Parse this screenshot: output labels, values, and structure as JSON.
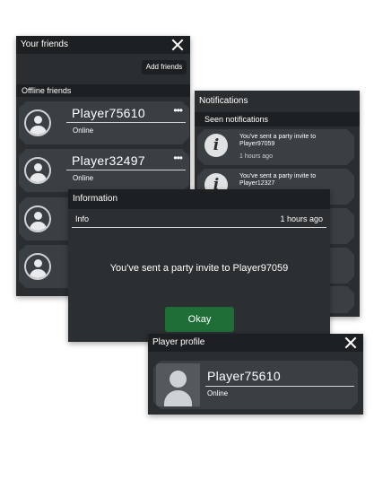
{
  "friends_panel": {
    "title": "Your friends",
    "add_friends_label": "Add friends",
    "offline_header": "Offline friends",
    "items": [
      {
        "name": "Player75610",
        "status": "Online",
        "menu": "•••"
      },
      {
        "name": "Player32497",
        "status": "Online",
        "menu": "•••"
      },
      {
        "name": "",
        "status": "",
        "menu": ""
      },
      {
        "name": "–",
        "status": "",
        "menu": ""
      }
    ]
  },
  "notifications_panel": {
    "title": "Notifications",
    "seen_header": "Seen notifications",
    "items": [
      {
        "icon": "info-icon",
        "text": "You've sent a party invite to Player97059",
        "time": "1 hours ago"
      },
      {
        "icon": "info-icon",
        "text": "You've sent a party invite to Player12327",
        "time": ""
      }
    ]
  },
  "info_modal": {
    "title": "Information",
    "header_label": "Info",
    "header_time": "1 hours ago",
    "message": "You've sent a party invite to Player97059",
    "okay_label": "Okay"
  },
  "player_profile": {
    "title": "Player profile",
    "name": "Player75610",
    "status": "Online"
  },
  "colors": {
    "panel_bg": "#2a2e31",
    "title_bg": "#1d2023",
    "row_bg": "#3a3f43",
    "okay_button": "#1f6e38"
  }
}
